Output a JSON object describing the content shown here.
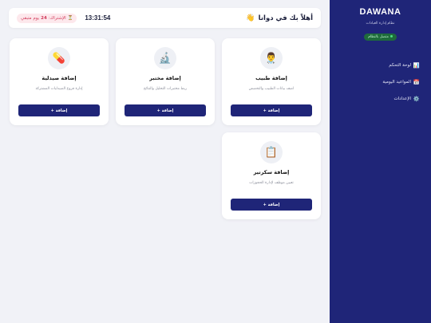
{
  "sidebar": {
    "brand": "DAWANA",
    "subtitle": "نظام إدارة العيادات",
    "status": "متصل بالنظام",
    "items": [
      {
        "icon": "📊",
        "label": "لوحة التحكم"
      },
      {
        "icon": "📅",
        "label": "المواعيد اليومية"
      },
      {
        "icon": "⚙️",
        "label": "الإعدادات"
      }
    ]
  },
  "header": {
    "welcome": "أهلاً بك في دوانا",
    "wave": "👋",
    "clock": "13:31:54",
    "subscription_prefix": "⏳ الإشتراك:",
    "subscription_days": "24",
    "subscription_suffix": "يوم متبقي"
  },
  "cards": [
    {
      "icon": "👨‍⚕️",
      "title": "إضافة طبيب",
      "desc": "اضف بيانات الطبيب والتخصص",
      "button": "إضافة +"
    },
    {
      "icon": "🔬",
      "title": "إضافة مختبر",
      "desc": "ربط مختبرات التحليل والنتائج",
      "button": "إضافة +"
    },
    {
      "icon": "💊",
      "title": "إضافة صيدلية",
      "desc": "إدارة فروع الصيدليات المشتركة",
      "button": "إضافة +"
    },
    {
      "icon": "📋",
      "title": "إضافة سكرتير",
      "desc": "تعيين موظف لإدارة الحجوزات",
      "button": "إضافة +"
    }
  ]
}
